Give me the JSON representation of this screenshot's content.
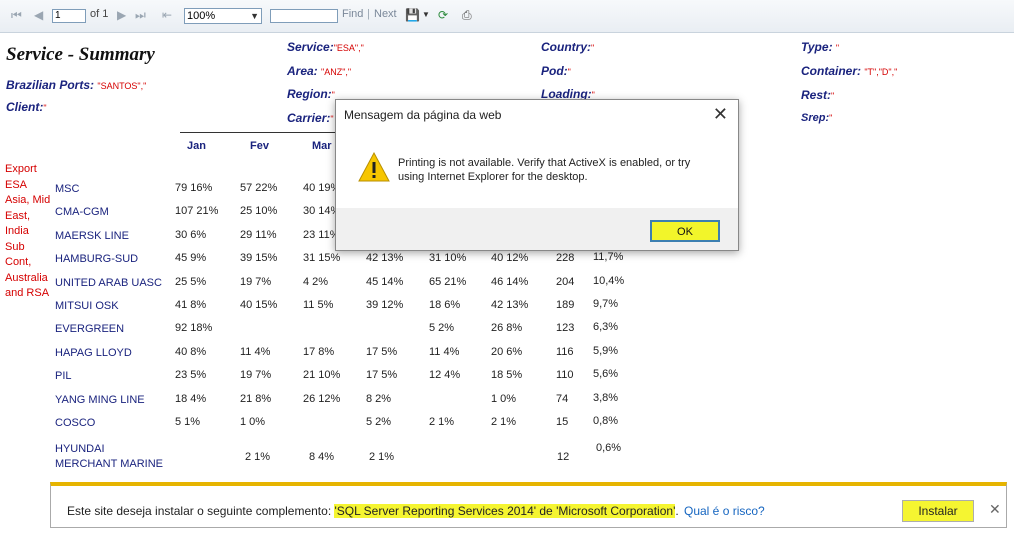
{
  "toolbar": {
    "page_value": "1",
    "page_of": "of 1",
    "zoom": "100%",
    "find": "Find",
    "separator": "|",
    "next": "Next"
  },
  "report": {
    "title": "Service - Summary",
    "filters": {
      "brazilian_ports_label": "Brazilian Ports:",
      "brazilian_ports_value": "\"SANTOS\",\"",
      "client_label": "Client:",
      "client_value": "\"",
      "service_label": "Service:",
      "service_value": "\"ESA\",\"",
      "area_label": "Area:",
      "area_value": "\"ANZ\",\"",
      "region_label": "Region:",
      "region_value": "\"",
      "carrier_label": "Carrier:",
      "carrier_value": "\"",
      "country_label": "Country:",
      "country_value": "\"",
      "pod_label": "Pod:",
      "pod_value": "\"",
      "loading_label": "Loading:",
      "loading_value": "\"",
      "type_label": "Type:",
      "type_value": "\"",
      "container_label": "Container:",
      "container_value": "\"T\",\"D\",\"",
      "rest_label": "Rest:",
      "rest_value": "\"",
      "srep_label": "Srep:",
      "srep_value": "\""
    },
    "months": [
      "Jan",
      "Fev",
      "Mar"
    ],
    "region_text": [
      "Export",
      " ESA",
      "Asia, Mid",
      "East,",
      "India",
      "Sub",
      "Cont,",
      "Australia",
      "and RSA"
    ],
    "rows": [
      {
        "carrier": "MSC",
        "c1": "79  16%",
        "c2": "57  22%",
        "c3": "40  19%",
        "c4": "",
        "c5": "",
        "c6": "",
        "total": "",
        "pct": ""
      },
      {
        "carrier": "CMA-CGM",
        "c1": "107  21%",
        "c2": "25  10%",
        "c3": "30  14%",
        "c4": "",
        "c5": "",
        "c6": "",
        "total": "",
        "pct": ""
      },
      {
        "carrier": "MAERSK LINE",
        "c1": "30  6%",
        "c2": "29  11%",
        "c3": "23  11%",
        "c4": "",
        "c5": "",
        "c6": "",
        "total": "",
        "pct": ""
      },
      {
        "carrier": "HAMBURG-SUD",
        "c1": "45  9%",
        "c2": "39  15%",
        "c3": "31  15%",
        "c4": "42  13%",
        "c5": "31  10%",
        "c6": "40  12%",
        "total": "228",
        "pct": "11,7%"
      },
      {
        "carrier": "UNITED ARAB UASC",
        "c1": "25  5%",
        "c2": "19  7%",
        "c3": "4  2%",
        "c4": "45  14%",
        "c5": "65  21%",
        "c6": "46  14%",
        "total": "204",
        "pct": "10,4%"
      },
      {
        "carrier": "MITSUI OSK",
        "c1": "41  8%",
        "c2": "40  15%",
        "c3": "11  5%",
        "c4": "39  12%",
        "c5": "18  6%",
        "c6": "42  13%",
        "total": "189",
        "pct": "9,7%"
      },
      {
        "carrier": "EVERGREEN",
        "c1": "92  18%",
        "c2": "",
        "c3": "",
        "c4": "",
        "c5": "5  2%",
        "c6": "26  8%",
        "total": "123",
        "pct": "6,3%"
      },
      {
        "carrier": "HAPAG LLOYD",
        "c1": "40  8%",
        "c2": "11  4%",
        "c3": "17  8%",
        "c4": "17  5%",
        "c5": "11  4%",
        "c6": "20  6%",
        "total": "116",
        "pct": "5,9%"
      },
      {
        "carrier": "PIL",
        "c1": "23  5%",
        "c2": "19  7%",
        "c3": "21  10%",
        "c4": "17  5%",
        "c5": "12  4%",
        "c6": "18  5%",
        "total": "110",
        "pct": "5,6%"
      },
      {
        "carrier": "YANG MING LINE",
        "c1": "18  4%",
        "c2": "21  8%",
        "c3": "26  12%",
        "c4": "8  2%",
        "c5": "",
        "c6": "1  0%",
        "total": "74",
        "pct": "3,8%"
      },
      {
        "carrier": "COSCO",
        "c1": "5  1%",
        "c2": "1  0%",
        "c3": "",
        "c4": "5  2%",
        "c5": "2  1%",
        "c6": "2  1%",
        "total": "15",
        "pct": "0,8%"
      }
    ],
    "last_row": {
      "carrier_line1": "HYUNDAI",
      "carrier_line2": "MERCHANT MARINE",
      "c2": "2  1%",
      "c3": "8  4%",
      "c4": "2  1%",
      "total": "12",
      "pct": "0,6%"
    }
  },
  "dialog": {
    "title": "Mensagem da página da web",
    "close": "✕",
    "message": "Printing is not available. Verify that ActiveX is enabled, or try using Internet Explorer for the desktop.",
    "ok": "OK"
  },
  "infobar": {
    "text_before": "Este site deseja instalar o seguinte complemento: ",
    "highlight": "'SQL Server Reporting Services 2014' de 'Microsoft Corporation'",
    "text_after": ".",
    "risk_link": "Qual é o risco?",
    "install": "Instalar",
    "close": "✕"
  },
  "colors": {
    "label_blue": "#1a237e",
    "value_red": "#d50000",
    "highlight_yellow": "#f5f531"
  }
}
